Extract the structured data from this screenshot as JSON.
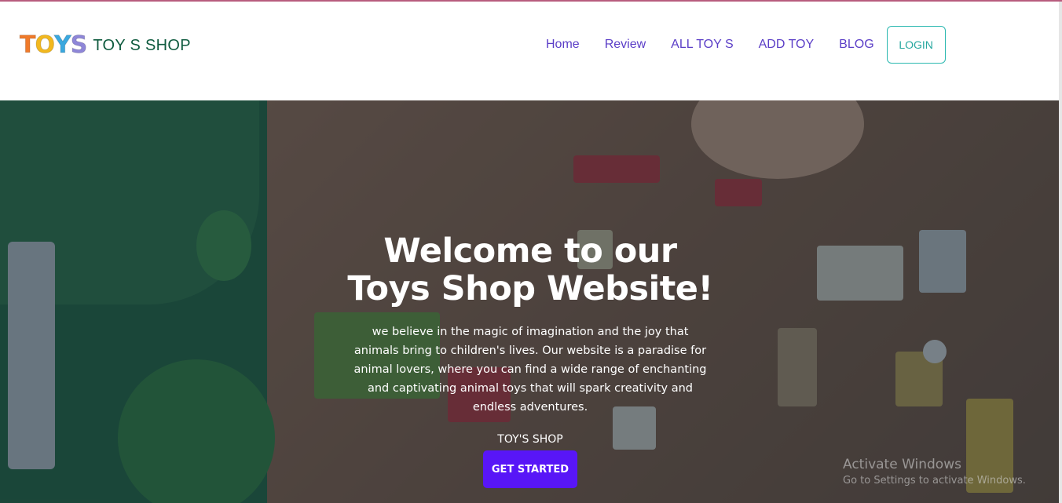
{
  "brand": {
    "logo_letters": [
      "T",
      "O",
      "Y",
      "S"
    ],
    "logo_colors": [
      "#f07a2a",
      "#f2b81f",
      "#3aa8df",
      "#8e86d8"
    ],
    "title": "TOY S SHOP"
  },
  "nav": {
    "items": [
      "Home",
      "Review",
      "ALL TOY S",
      "ADD TOY",
      "BLOG"
    ],
    "login": "LOGIN"
  },
  "hero": {
    "title_line1": "Welcome to our",
    "title_line2": "Toys Shop Website!",
    "text": "we believe in the magic of imagination and the joy that animals bring to children's lives. Our website is a paradise for animal lovers, where you can find a wide range of enchanting and captivating animal toys that will spark creativity and endless adventures.",
    "subtitle": "TOY'S SHOP",
    "button": "GET STARTED"
  },
  "watermark": {
    "title": "Activate Windows",
    "subtitle": "Go to Settings to activate Windows."
  },
  "colors": {
    "nav_link": "#5b3ec7",
    "login_border": "#2bb8b0",
    "cta": "#5816f7",
    "brand_title": "#0f5b3f"
  }
}
